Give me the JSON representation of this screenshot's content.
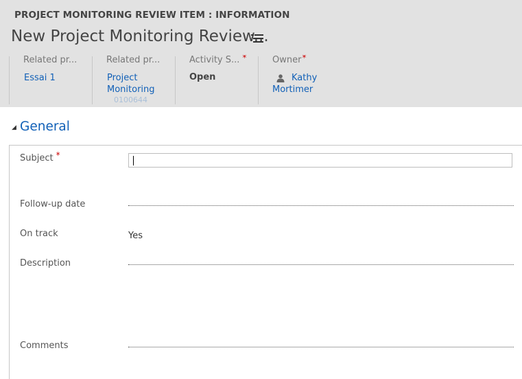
{
  "header": {
    "entity_label": "PROJECT MONITORING REVIEW ITEM : INFORMATION",
    "record_title": "New Project Monitoring Review...",
    "fields": [
      {
        "label": "Related pr...",
        "value": "Essai 1"
      },
      {
        "label": "Related pr...",
        "value_line1": "Project",
        "value_line2": "Monitoring",
        "value_line3": "0100644"
      },
      {
        "label": "Activity S...",
        "required_mark": "*",
        "value": "Open"
      },
      {
        "label": "Owner",
        "required_mark": "*",
        "value_line1": "Kathy",
        "value_line2": "Mortimer"
      }
    ]
  },
  "section": {
    "toggle": "◢",
    "title": "General"
  },
  "form": {
    "subject_label": "Subject",
    "subject_required": "*",
    "subject_value": "",
    "followup_label": "Follow-up date",
    "ontrack_label": "On track",
    "ontrack_value": "Yes",
    "description_label": "Description",
    "comments_label": "Comments"
  },
  "colors": {
    "header_bg": "#e2e2e2",
    "link": "#1160b7",
    "required": "#cc0000"
  }
}
